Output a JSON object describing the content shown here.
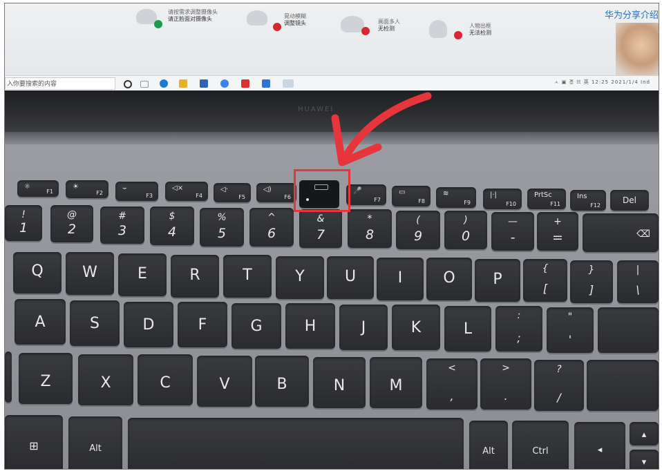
{
  "screen": {
    "tips": [
      {
        "line1": "请按需求调整摄像头",
        "line2": "请正脸面对摄像头",
        "status": "ok"
      },
      {
        "line1": "晃动模糊",
        "line2": "调整镜头",
        "status": "bad"
      },
      {
        "line1": "画面多人",
        "line2": "无检测",
        "status": "bad"
      },
      {
        "line1": "人物出框",
        "line2": "无法检测",
        "status": "bad"
      }
    ],
    "brand_text": "华为分享介绍",
    "search_placeholder": "入你要搜索的内容",
    "tray_time": "12:25",
    "tray_date": "2021/1/4",
    "tray_extra": "ㅅ ▣ 곘 ☷ 英",
    "tray_tail": "Ind"
  },
  "bezel": {
    "logo": "HUAWEI"
  },
  "keyboard": {
    "f_row": [
      {
        "icon": "☼",
        "fn": "F1"
      },
      {
        "icon": "☀",
        "fn": "F2"
      },
      {
        "icon": "⌣",
        "fn": "F3"
      },
      {
        "icon": "◁×",
        "fn": "F4"
      },
      {
        "icon": "◁·",
        "fn": "F5"
      },
      {
        "icon": "◁)",
        "fn": "F6"
      },
      {
        "icon": "🎤",
        "fn": "F7"
      },
      {
        "icon": "▭",
        "fn": "F8"
      },
      {
        "icon": "≋",
        "fn": "F9"
      },
      {
        "icon": "|·|",
        "fn": "F10"
      },
      {
        "icon": "PrtSc",
        "fn": "F11"
      },
      {
        "icon": "Ins",
        "fn": "F12"
      },
      {
        "icon": "Del",
        "fn": ""
      }
    ],
    "num_row": [
      {
        "top": "!",
        "main": "1"
      },
      {
        "top": "@",
        "main": "2"
      },
      {
        "top": "#",
        "main": "3"
      },
      {
        "top": "$",
        "main": "4"
      },
      {
        "top": "%",
        "main": "5"
      },
      {
        "top": "^",
        "main": "6"
      },
      {
        "top": "&",
        "main": "7"
      },
      {
        "top": "*",
        "main": "8"
      },
      {
        "top": "(",
        "main": "9"
      },
      {
        "top": ")",
        "main": "0"
      },
      {
        "top": "—",
        "main": "-"
      },
      {
        "top": "+",
        "main": "="
      },
      {
        "top": "",
        "main": "⌫"
      }
    ],
    "q_row": [
      "Q",
      "W",
      "E",
      "R",
      "T",
      "Y",
      "U",
      "I",
      "O",
      "P"
    ],
    "q_extra": [
      {
        "top": "{",
        "main": "["
      },
      {
        "top": "}",
        "main": "]"
      },
      {
        "top": "|",
        "main": "\\"
      }
    ],
    "a_row": [
      "A",
      "S",
      "D",
      "F",
      "G",
      "H",
      "J",
      "K",
      "L"
    ],
    "a_extra": [
      {
        "top": ":",
        "main": ";"
      },
      {
        "top": "\"",
        "main": "'"
      }
    ],
    "z_row": [
      "Z",
      "X",
      "C",
      "V",
      "B",
      "N",
      "M"
    ],
    "z_extra": [
      {
        "top": "<",
        "main": ","
      },
      {
        "top": ">",
        "main": "."
      },
      {
        "top": "?",
        "main": "/"
      }
    ],
    "bottom": {
      "win": "⊞",
      "alt_left": "Alt",
      "alt_right": "Alt",
      "ctrl": "Ctrl",
      "left": "◂",
      "up": "▴",
      "down": "▾"
    }
  },
  "annotation": {
    "color": "#e8343b"
  }
}
